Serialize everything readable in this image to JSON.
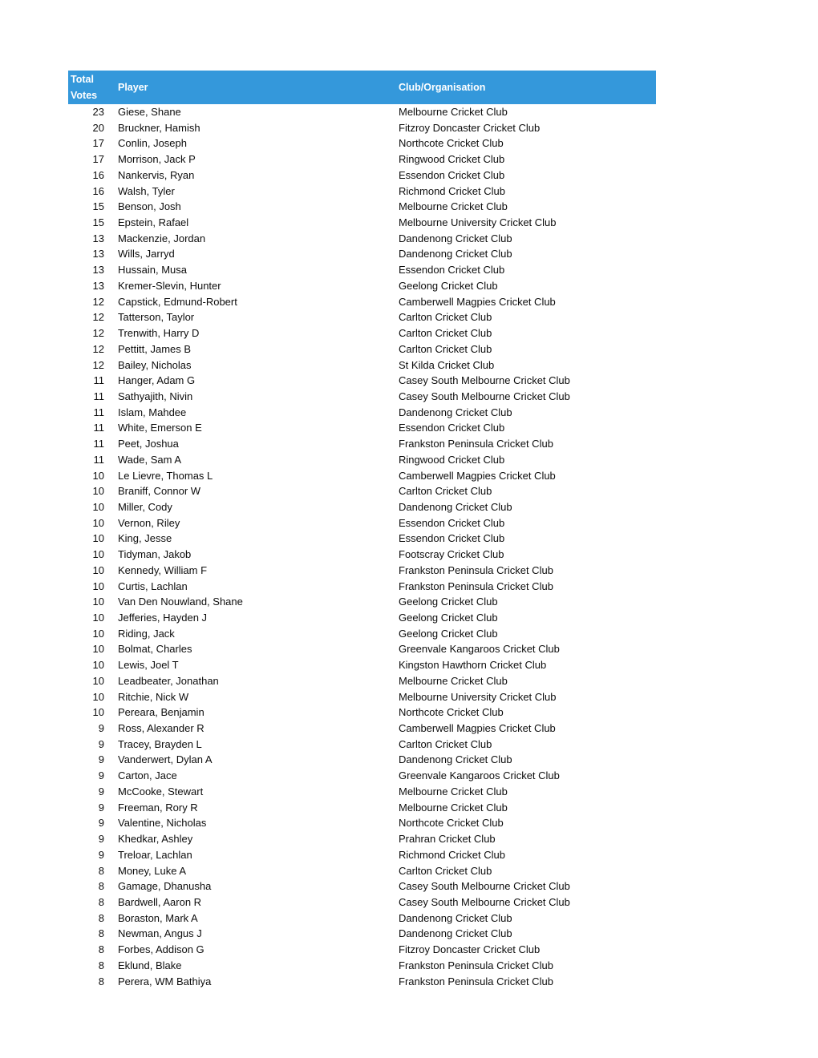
{
  "table": {
    "header": {
      "votes_line1": "Total",
      "votes_line2": "Votes",
      "player": "Player",
      "club": "Club/Organisation"
    },
    "header_bg_color": "#3498db",
    "header_text_color": "#ffffff",
    "body_text_color": "#0d0d0d",
    "page_background": "#ffffff",
    "row_count": 58,
    "rows": [
      {
        "votes": "23",
        "player": "Giese, Shane",
        "club": "Melbourne Cricket Club"
      },
      {
        "votes": "20",
        "player": "Bruckner, Hamish",
        "club": "Fitzroy Doncaster Cricket Club"
      },
      {
        "votes": "17",
        "player": "Conlin, Joseph",
        "club": "Northcote Cricket Club"
      },
      {
        "votes": "17",
        "player": "Morrison, Jack P",
        "club": "Ringwood Cricket Club"
      },
      {
        "votes": "16",
        "player": "Nankervis, Ryan",
        "club": "Essendon Cricket Club"
      },
      {
        "votes": "16",
        "player": "Walsh, Tyler",
        "club": "Richmond Cricket Club"
      },
      {
        "votes": "15",
        "player": "Benson, Josh",
        "club": "Melbourne Cricket Club"
      },
      {
        "votes": "15",
        "player": "Epstein, Rafael",
        "club": "Melbourne University Cricket Club"
      },
      {
        "votes": "13",
        "player": "Mackenzie, Jordan",
        "club": "Dandenong Cricket Club"
      },
      {
        "votes": "13",
        "player": "Wills, Jarryd",
        "club": "Dandenong Cricket Club"
      },
      {
        "votes": "13",
        "player": "Hussain, Musa",
        "club": "Essendon Cricket Club"
      },
      {
        "votes": "13",
        "player": "Kremer-Slevin, Hunter",
        "club": "Geelong Cricket Club"
      },
      {
        "votes": "12",
        "player": "Capstick, Edmund-Robert",
        "club": "Camberwell Magpies Cricket Club"
      },
      {
        "votes": "12",
        "player": "Tatterson, Taylor",
        "club": "Carlton Cricket Club"
      },
      {
        "votes": "12",
        "player": "Trenwith, Harry D",
        "club": "Carlton Cricket Club"
      },
      {
        "votes": "12",
        "player": "Pettitt, James B",
        "club": "Carlton Cricket Club"
      },
      {
        "votes": "12",
        "player": "Bailey, Nicholas",
        "club": "St Kilda Cricket Club"
      },
      {
        "votes": "11",
        "player": "Hanger, Adam G",
        "club": "Casey South Melbourne Cricket Club"
      },
      {
        "votes": "11",
        "player": "Sathyajith, Nivin",
        "club": "Casey South Melbourne Cricket Club"
      },
      {
        "votes": "11",
        "player": "Islam, Mahdee",
        "club": "Dandenong Cricket Club"
      },
      {
        "votes": "11",
        "player": "White, Emerson E",
        "club": "Essendon Cricket Club"
      },
      {
        "votes": "11",
        "player": "Peet, Joshua",
        "club": "Frankston Peninsula Cricket Club"
      },
      {
        "votes": "11",
        "player": "Wade, Sam A",
        "club": "Ringwood Cricket Club"
      },
      {
        "votes": "10",
        "player": "Le Lievre, Thomas L",
        "club": "Camberwell Magpies Cricket Club"
      },
      {
        "votes": "10",
        "player": "Braniff, Connor W",
        "club": "Carlton Cricket Club"
      },
      {
        "votes": "10",
        "player": "Miller, Cody",
        "club": "Dandenong Cricket Club"
      },
      {
        "votes": "10",
        "player": "Vernon, Riley",
        "club": "Essendon Cricket Club"
      },
      {
        "votes": "10",
        "player": "King, Jesse",
        "club": "Essendon Cricket Club"
      },
      {
        "votes": "10",
        "player": "Tidyman, Jakob",
        "club": "Footscray Cricket Club"
      },
      {
        "votes": "10",
        "player": "Kennedy, William F",
        "club": "Frankston Peninsula Cricket Club"
      },
      {
        "votes": "10",
        "player": "Curtis, Lachlan",
        "club": "Frankston Peninsula Cricket Club"
      },
      {
        "votes": "10",
        "player": "Van Den Nouwland, Shane",
        "club": "Geelong Cricket Club"
      },
      {
        "votes": "10",
        "player": "Jefferies, Hayden J",
        "club": "Geelong Cricket Club"
      },
      {
        "votes": "10",
        "player": "Riding, Jack",
        "club": "Geelong Cricket Club"
      },
      {
        "votes": "10",
        "player": "Bolmat, Charles",
        "club": "Greenvale Kangaroos Cricket Club"
      },
      {
        "votes": "10",
        "player": "Lewis, Joel T",
        "club": "Kingston Hawthorn Cricket Club"
      },
      {
        "votes": "10",
        "player": "Leadbeater, Jonathan",
        "club": "Melbourne Cricket Club"
      },
      {
        "votes": "10",
        "player": "Ritchie, Nick W",
        "club": "Melbourne University Cricket Club"
      },
      {
        "votes": "10",
        "player": "Pereara, Benjamin",
        "club": "Northcote Cricket Club"
      },
      {
        "votes": "9",
        "player": "Ross, Alexander R",
        "club": "Camberwell Magpies Cricket Club"
      },
      {
        "votes": "9",
        "player": "Tracey, Brayden L",
        "club": "Carlton Cricket Club"
      },
      {
        "votes": "9",
        "player": "Vanderwert, Dylan A",
        "club": "Dandenong Cricket Club"
      },
      {
        "votes": "9",
        "player": "Carton, Jace",
        "club": "Greenvale Kangaroos Cricket Club"
      },
      {
        "votes": "9",
        "player": "McCooke, Stewart",
        "club": "Melbourne Cricket Club"
      },
      {
        "votes": "9",
        "player": "Freeman, Rory R",
        "club": "Melbourne Cricket Club"
      },
      {
        "votes": "9",
        "player": "Valentine, Nicholas",
        "club": "Northcote Cricket Club"
      },
      {
        "votes": "9",
        "player": "Khedkar, Ashley",
        "club": "Prahran Cricket Club"
      },
      {
        "votes": "9",
        "player": "Treloar, Lachlan",
        "club": "Richmond Cricket Club"
      },
      {
        "votes": "8",
        "player": "Money, Luke A",
        "club": "Carlton Cricket Club"
      },
      {
        "votes": "8",
        "player": "Gamage, Dhanusha",
        "club": "Casey South Melbourne Cricket Club"
      },
      {
        "votes": "8",
        "player": "Bardwell, Aaron R",
        "club": "Casey South Melbourne Cricket Club"
      },
      {
        "votes": "8",
        "player": "Boraston, Mark A",
        "club": "Dandenong Cricket Club"
      },
      {
        "votes": "8",
        "player": "Newman, Angus J",
        "club": "Dandenong Cricket Club"
      },
      {
        "votes": "8",
        "player": "Forbes, Addison G",
        "club": "Fitzroy Doncaster Cricket Club"
      },
      {
        "votes": "8",
        "player": "Eklund, Blake",
        "club": "Frankston Peninsula Cricket Club"
      },
      {
        "votes": "8",
        "player": "Perera, WM Bathiya",
        "club": "Frankston Peninsula Cricket Club"
      }
    ]
  }
}
